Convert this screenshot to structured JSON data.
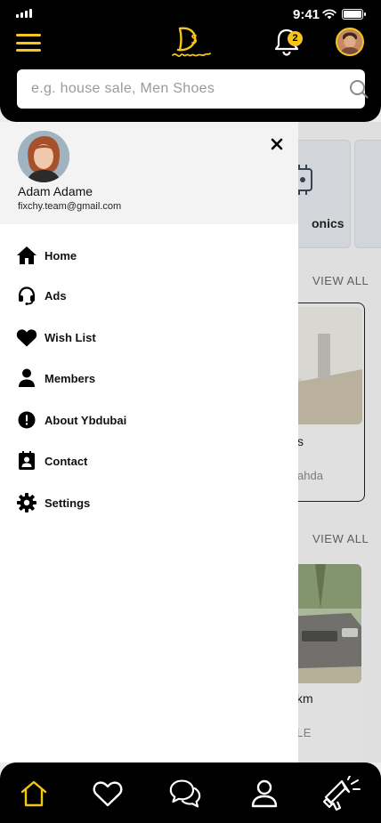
{
  "status_bar": {
    "time": "9:41"
  },
  "header": {
    "notification_count": "2",
    "search_placeholder": "e.g. house sale, Men Shoes"
  },
  "background": {
    "category_label": "onics",
    "view_all_1": "VIEW ALL",
    "view_all_2": "VIEW ALL",
    "ad1_title": "s",
    "ad1_location": "ahda",
    "ad2_title": "km",
    "ad2_tag": "LE"
  },
  "drawer": {
    "user_name": "Adam Adame",
    "user_email": "fixchy.team@gmail.com",
    "items": [
      {
        "label": "Home",
        "icon": "home-icon"
      },
      {
        "label": "Ads",
        "icon": "headset-icon"
      },
      {
        "label": "Wish List",
        "icon": "heart-icon"
      },
      {
        "label": "Members",
        "icon": "person-icon"
      },
      {
        "label": "About Ybdubai",
        "icon": "info-icon"
      },
      {
        "label": "Contact",
        "icon": "contact-icon"
      },
      {
        "label": "Settings",
        "icon": "gear-icon"
      }
    ]
  },
  "bottom_nav": {
    "items": [
      "home-icon",
      "heart-icon",
      "chat-icon",
      "profile-icon",
      "megaphone-icon"
    ],
    "active_color": "#f5c518",
    "inactive_color": "#ffffff"
  }
}
